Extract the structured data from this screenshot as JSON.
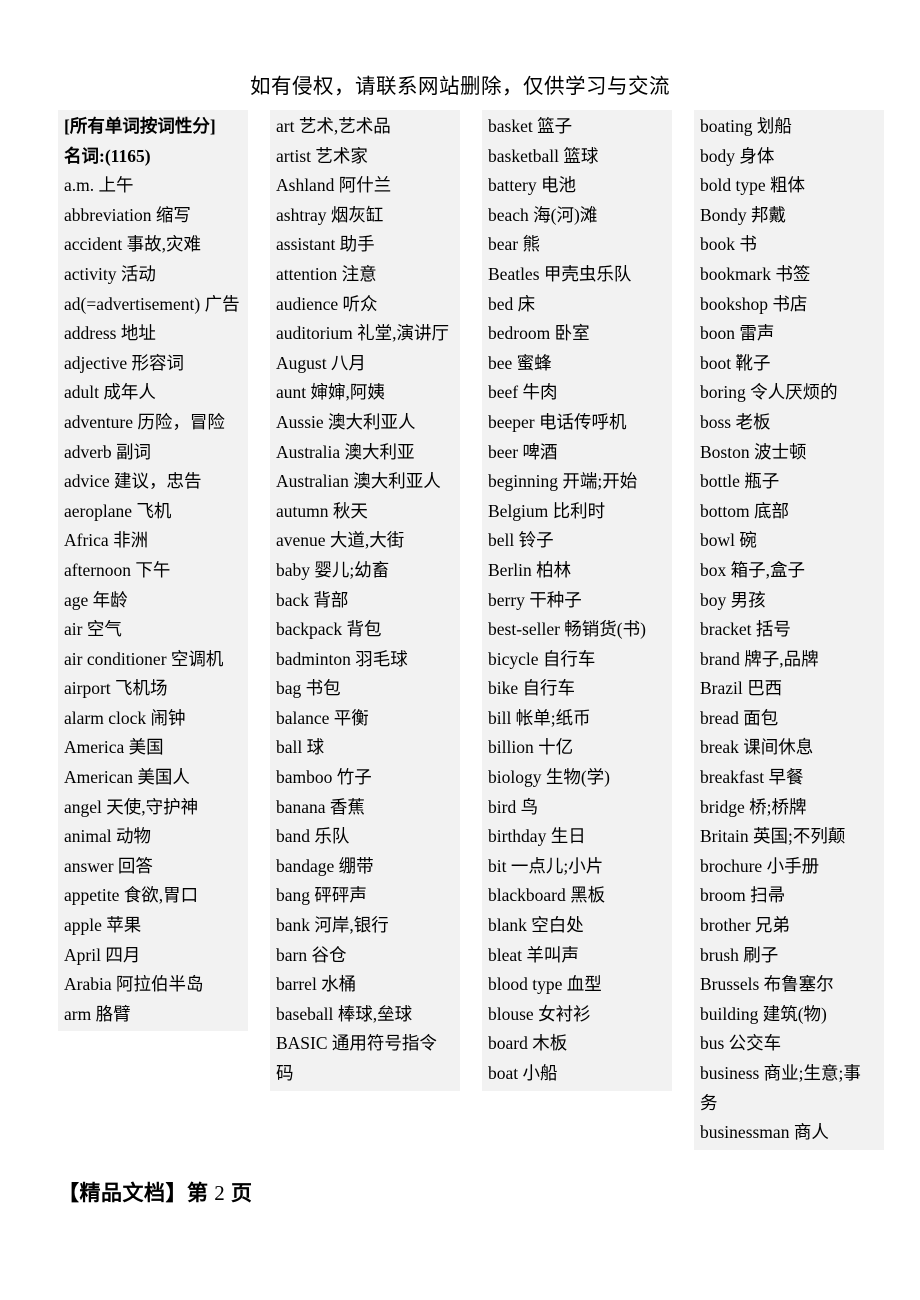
{
  "document": {
    "header_notice": "如有侵权，请联系网站删除，仅供学习与交流",
    "footer_label": "【精品文档】第",
    "footer_page_number": "2",
    "footer_suffix": "页"
  },
  "columns": [
    {
      "entries": [
        {
          "text": "[所有单词按词性分]",
          "bold": true
        },
        {
          "text": "名词:(1165)",
          "bold": true
        },
        {
          "text": "a.m. 上午",
          "bold": false
        },
        {
          "text": "abbreviation 缩写",
          "bold": false
        },
        {
          "text": "accident 事故,灾难",
          "bold": false
        },
        {
          "text": "activity 活动",
          "bold": false
        },
        {
          "text": "ad(=advertisement) 广告",
          "bold": false
        },
        {
          "text": "address 地址",
          "bold": false
        },
        {
          "text": "adjective 形容词",
          "bold": false
        },
        {
          "text": "adult 成年人",
          "bold": false
        },
        {
          "text": "adventure 历险，冒险",
          "bold": false
        },
        {
          "text": "adverb 副词",
          "bold": false
        },
        {
          "text": "advice 建议，忠告",
          "bold": false
        },
        {
          "text": "aeroplane 飞机",
          "bold": false
        },
        {
          "text": "Africa 非洲",
          "bold": false
        },
        {
          "text": "afternoon 下午",
          "bold": false
        },
        {
          "text": "age 年龄",
          "bold": false
        },
        {
          "text": "air 空气",
          "bold": false
        },
        {
          "text": "air conditioner 空调机",
          "bold": false
        },
        {
          "text": "airport 飞机场",
          "bold": false
        },
        {
          "text": "alarm clock 闹钟",
          "bold": false
        },
        {
          "text": "America 美国",
          "bold": false
        },
        {
          "text": "American 美国人",
          "bold": false
        },
        {
          "text": "angel 天使,守护神",
          "bold": false
        },
        {
          "text": "animal 动物",
          "bold": false
        },
        {
          "text": "answer 回答",
          "bold": false
        },
        {
          "text": "appetite 食欲,胃口",
          "bold": false
        },
        {
          "text": "apple 苹果",
          "bold": false
        },
        {
          "text": "April 四月",
          "bold": false
        },
        {
          "text": "Arabia 阿拉伯半岛",
          "bold": false
        },
        {
          "text": "arm 胳臂",
          "bold": false
        }
      ]
    },
    {
      "entries": [
        {
          "text": "art 艺术,艺术品",
          "bold": false
        },
        {
          "text": "artist 艺术家",
          "bold": false
        },
        {
          "text": "Ashland 阿什兰",
          "bold": false
        },
        {
          "text": "ashtray 烟灰缸",
          "bold": false
        },
        {
          "text": "assistant 助手",
          "bold": false
        },
        {
          "text": "attention 注意",
          "bold": false
        },
        {
          "text": "audience 听众",
          "bold": false
        },
        {
          "text": "auditorium 礼堂,演讲厅",
          "bold": false
        },
        {
          "text": "August 八月",
          "bold": false
        },
        {
          "text": "aunt 婶婶,阿姨",
          "bold": false
        },
        {
          "text": "Aussie 澳大利亚人",
          "bold": false
        },
        {
          "text": "Australia 澳大利亚",
          "bold": false
        },
        {
          "text": "Australian 澳大利亚人",
          "bold": false
        },
        {
          "text": "autumn 秋天",
          "bold": false
        },
        {
          "text": "avenue 大道,大街",
          "bold": false
        },
        {
          "text": "baby 婴儿;幼畜",
          "bold": false
        },
        {
          "text": "back 背部",
          "bold": false
        },
        {
          "text": "backpack 背包",
          "bold": false
        },
        {
          "text": "badminton 羽毛球",
          "bold": false
        },
        {
          "text": "bag 书包",
          "bold": false
        },
        {
          "text": "balance 平衡",
          "bold": false
        },
        {
          "text": "ball 球",
          "bold": false
        },
        {
          "text": "bamboo 竹子",
          "bold": false
        },
        {
          "text": "banana 香蕉",
          "bold": false
        },
        {
          "text": "band 乐队",
          "bold": false
        },
        {
          "text": "bandage 绷带",
          "bold": false
        },
        {
          "text": "bang 砰砰声",
          "bold": false
        },
        {
          "text": "bank 河岸,银行",
          "bold": false
        },
        {
          "text": "barn 谷仓",
          "bold": false
        },
        {
          "text": "barrel 水桶",
          "bold": false
        },
        {
          "text": "baseball 棒球,垒球",
          "bold": false
        },
        {
          "text": "BASIC 通用符号指令码",
          "bold": false
        }
      ]
    },
    {
      "entries": [
        {
          "text": "basket 篮子",
          "bold": false
        },
        {
          "text": "basketball 篮球",
          "bold": false
        },
        {
          "text": "battery 电池",
          "bold": false
        },
        {
          "text": "beach  海(河)滩",
          "bold": false
        },
        {
          "text": "bear 熊",
          "bold": false
        },
        {
          "text": "Beatles 甲壳虫乐队",
          "bold": false
        },
        {
          "text": "bed 床",
          "bold": false
        },
        {
          "text": "bedroom 卧室",
          "bold": false
        },
        {
          "text": "bee 蜜蜂",
          "bold": false
        },
        {
          "text": "beef 牛肉",
          "bold": false
        },
        {
          "text": "beeper 电话传呼机",
          "bold": false
        },
        {
          "text": "beer 啤酒",
          "bold": false
        },
        {
          "text": "beginning 开端;开始",
          "bold": false
        },
        {
          "text": "Belgium 比利时",
          "bold": false
        },
        {
          "text": "bell 铃子",
          "bold": false
        },
        {
          "text": "Berlin 柏林",
          "bold": false
        },
        {
          "text": "berry 干种子",
          "bold": false
        },
        {
          "text": "best-seller 畅销货(书)",
          "bold": false
        },
        {
          "text": "bicycle 自行车",
          "bold": false
        },
        {
          "text": "bike 自行车",
          "bold": false
        },
        {
          "text": "bill 帐单;纸币",
          "bold": false
        },
        {
          "text": "billion 十亿",
          "bold": false
        },
        {
          "text": "biology 生物(学)",
          "bold": false
        },
        {
          "text": "bird 鸟",
          "bold": false
        },
        {
          "text": "birthday 生日",
          "bold": false
        },
        {
          "text": "bit  一点儿;小片",
          "bold": false
        },
        {
          "text": "blackboard 黑板",
          "bold": false
        },
        {
          "text": "blank 空白处",
          "bold": false
        },
        {
          "text": "bleat 羊叫声",
          "bold": false
        },
        {
          "text": "blood type 血型",
          "bold": false
        },
        {
          "text": "blouse 女衬衫",
          "bold": false
        },
        {
          "text": "board 木板",
          "bold": false
        },
        {
          "text": "boat 小船",
          "bold": false
        }
      ]
    },
    {
      "entries": [
        {
          "text": "boating 划船",
          "bold": false
        },
        {
          "text": "body 身体",
          "bold": false
        },
        {
          "text": "bold type 粗体",
          "bold": false
        },
        {
          "text": "Bondy 邦戴",
          "bold": false
        },
        {
          "text": "book 书",
          "bold": false
        },
        {
          "text": "bookmark 书签",
          "bold": false
        },
        {
          "text": "bookshop 书店",
          "bold": false
        },
        {
          "text": "boon 雷声",
          "bold": false
        },
        {
          "text": "boot 靴子",
          "bold": false
        },
        {
          "text": "boring 令人厌烦的",
          "bold": false
        },
        {
          "text": "boss 老板",
          "bold": false
        },
        {
          "text": "Boston 波士顿",
          "bold": false
        },
        {
          "text": "bottle 瓶子",
          "bold": false
        },
        {
          "text": "bottom 底部",
          "bold": false
        },
        {
          "text": "bowl 碗",
          "bold": false
        },
        {
          "text": "box 箱子,盒子",
          "bold": false
        },
        {
          "text": "boy 男孩",
          "bold": false
        },
        {
          "text": "bracket 括号",
          "bold": false
        },
        {
          "text": "brand  牌子,品牌",
          "bold": false
        },
        {
          "text": "Brazil 巴西",
          "bold": false
        },
        {
          "text": "bread 面包",
          "bold": false
        },
        {
          "text": "break 课间休息",
          "bold": false
        },
        {
          "text": "breakfast 早餐",
          "bold": false
        },
        {
          "text": "bridge 桥;桥牌",
          "bold": false
        },
        {
          "text": "Britain 英国;不列颠",
          "bold": false
        },
        {
          "text": "brochure 小手册",
          "bold": false
        },
        {
          "text": "broom 扫帚",
          "bold": false
        },
        {
          "text": "brother 兄弟",
          "bold": false
        },
        {
          "text": "brush 刷子",
          "bold": false
        },
        {
          "text": "Brussels 布鲁塞尔",
          "bold": false
        },
        {
          "text": "building 建筑(物)",
          "bold": false
        },
        {
          "text": "bus 公交车",
          "bold": false
        },
        {
          "text": "business 商业;生意;事务",
          "bold": false
        },
        {
          "text": "businessman 商人",
          "bold": false
        }
      ]
    }
  ]
}
